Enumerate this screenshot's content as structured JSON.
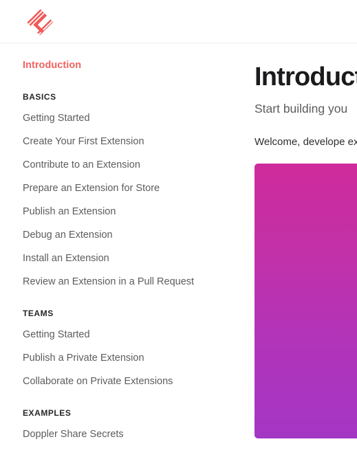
{
  "header": {
    "logo_icon": "diamond-logo-icon",
    "logo_color": "#ef5a5a"
  },
  "sidebar": {
    "active_item": {
      "label": "Introduction",
      "color": "#f0625f"
    },
    "groups": [
      {
        "section": "BASICS",
        "items": [
          "Getting Started",
          "Create Your First Extension",
          "Contribute to an Extension",
          "Prepare an Extension for Store",
          "Publish an Extension",
          "Debug an Extension",
          "Install an Extension",
          "Review an Extension in a Pull Request"
        ]
      },
      {
        "section": "TEAMS",
        "items": [
          "Getting Started",
          "Publish a Private Extension",
          "Collaborate on Private Extensions"
        ]
      },
      {
        "section": "EXAMPLES",
        "items": [
          "Doppler Share Secrets"
        ]
      }
    ]
  },
  "main": {
    "title": "Introduction",
    "subtitle": "Start building you",
    "paragraph": "Welcome, develope extensions and shar",
    "hero": {
      "gradient_top": "#cf2b9c",
      "gradient_bottom": "#a436c4",
      "panel_color": "#2b1022"
    }
  }
}
